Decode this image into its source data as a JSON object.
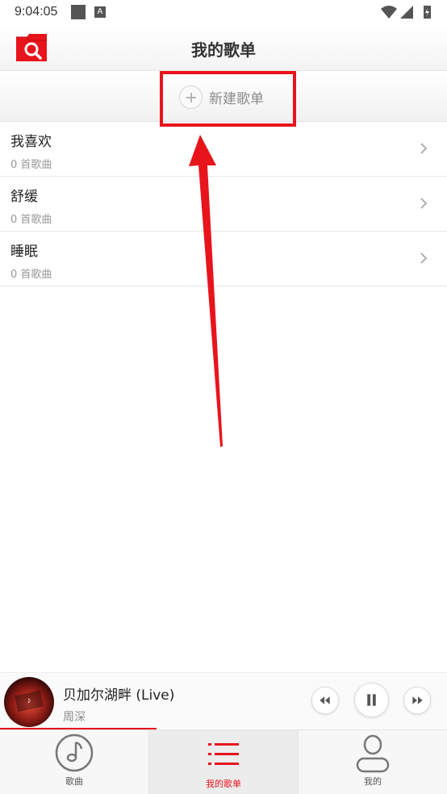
{
  "status_bar": {
    "time": "9:04:05",
    "a_icon_text": "A"
  },
  "header": {
    "title": "我的歌单"
  },
  "new_playlist": {
    "label": "新建歌单"
  },
  "playlists": [
    {
      "name": "我喜欢",
      "count": "0 首歌曲"
    },
    {
      "name": "舒缓",
      "count": "0 首歌曲"
    },
    {
      "name": "睡眠",
      "count": "0 首歌曲"
    }
  ],
  "player": {
    "title": "贝加尔湖畔 (Live)",
    "artist": "周深",
    "progress_fraction": 0.35
  },
  "tabs": [
    {
      "label": "歌曲",
      "icon": "music-note-icon",
      "active": false
    },
    {
      "label": "我的歌单",
      "icon": "list-icon",
      "active": true
    },
    {
      "label": "我的",
      "icon": "user-icon",
      "active": false
    }
  ],
  "colors": {
    "accent": "#e8141c",
    "annotation": "#e8141c"
  }
}
